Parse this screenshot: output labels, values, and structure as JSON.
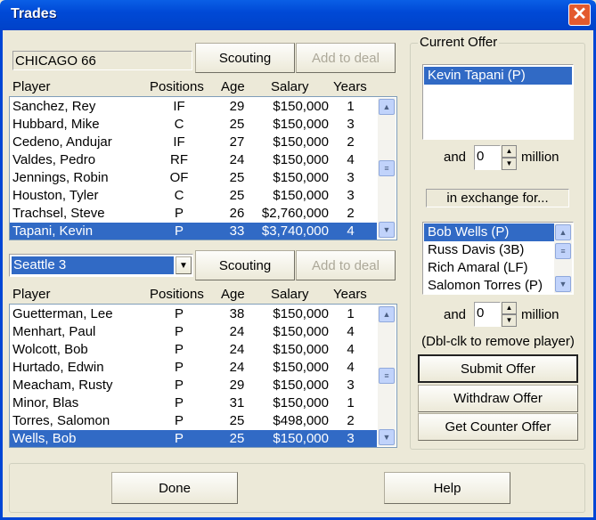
{
  "window": {
    "title": "Trades",
    "close_glyph": "✕"
  },
  "team1": {
    "name": "CHICAGO 66",
    "scouting": "Scouting",
    "add_to_deal": "Add to deal",
    "headers": [
      "Player",
      "Positions",
      "Age",
      "Salary",
      "Years"
    ],
    "rows": [
      [
        "Sanchez, Rey",
        "IF",
        "29",
        "$150,000",
        "1"
      ],
      [
        "Hubbard, Mike",
        "C",
        "25",
        "$150,000",
        "3"
      ],
      [
        "Cedeno, Andujar",
        "IF",
        "27",
        "$150,000",
        "2"
      ],
      [
        "Valdes, Pedro",
        "RF",
        "24",
        "$150,000",
        "4"
      ],
      [
        "Jennings, Robin",
        "OF",
        "25",
        "$150,000",
        "3"
      ],
      [
        "Houston, Tyler",
        "C",
        "25",
        "$150,000",
        "3"
      ],
      [
        "Trachsel, Steve",
        "P",
        "26",
        "$2,760,000",
        "2"
      ],
      [
        "Tapani, Kevin",
        "P",
        "33",
        "$3,740,000",
        "4"
      ]
    ],
    "selected": 7
  },
  "team2": {
    "name": "Seattle 3",
    "scouting": "Scouting",
    "add_to_deal": "Add to deal",
    "headers": [
      "Player",
      "Positions",
      "Age",
      "Salary",
      "Years"
    ],
    "rows": [
      [
        "Guetterman, Lee",
        "P",
        "38",
        "$150,000",
        "1"
      ],
      [
        "Menhart, Paul",
        "P",
        "24",
        "$150,000",
        "4"
      ],
      [
        "Wolcott, Bob",
        "P",
        "24",
        "$150,000",
        "4"
      ],
      [
        "Hurtado, Edwin",
        "P",
        "24",
        "$150,000",
        "4"
      ],
      [
        "Meacham, Rusty",
        "P",
        "29",
        "$150,000",
        "3"
      ],
      [
        "Minor, Blas",
        "P",
        "31",
        "$150,000",
        "1"
      ],
      [
        "Torres, Salomon",
        "P",
        "25",
        "$498,000",
        "2"
      ],
      [
        "Wells, Bob",
        "P",
        "25",
        "$150,000",
        "3"
      ]
    ],
    "selected": 7
  },
  "offer": {
    "title": "Current Offer",
    "offered": [
      "Kevin Tapani (P)"
    ],
    "and": "and",
    "million": "million",
    "money1": "0",
    "exchange_label": "in exchange for...",
    "requested": [
      "Bob Wells (P)",
      "Russ Davis (3B)",
      "Rich Amaral (LF)",
      "Salomon Torres (P)"
    ],
    "money2": "0",
    "hint": "(Dbl-clk to remove player)",
    "submit": "Submit Offer",
    "withdraw": "Withdraw Offer",
    "counter": "Get Counter Offer"
  },
  "footer": {
    "done": "Done",
    "help": "Help"
  }
}
